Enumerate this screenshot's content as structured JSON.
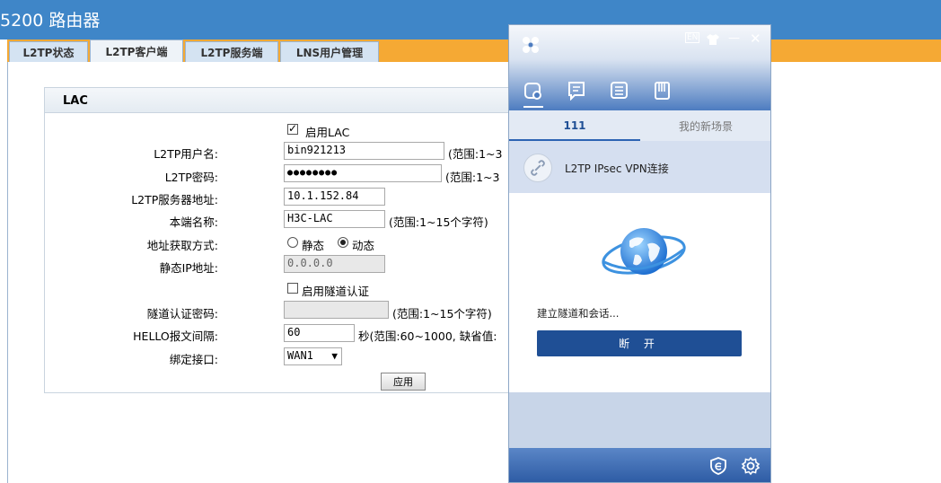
{
  "page": {
    "title": "5200 路由器",
    "tabs": [
      {
        "label": "L2TP状态"
      },
      {
        "label": "L2TP客户端",
        "active": true
      },
      {
        "label": "L2TP服务端"
      },
      {
        "label": "LNS用户管理"
      }
    ]
  },
  "lac": {
    "header": "LAC",
    "enable_lac_label": "启用LAC",
    "enable_lac_checked": true,
    "username_label": "L2TP用户名:",
    "username_value": "bin921213",
    "username_hint": "(范围:1~3",
    "password_label": "L2TP密码:",
    "password_value": "●●●●●●●●",
    "password_hint": "(范围:1~3",
    "server_label": "L2TP服务器地址:",
    "server_value": "10.1.152.84",
    "localname_label": "本端名称:",
    "localname_value": "H3C-LAC",
    "localname_hint": "(范围:1~15个字符)",
    "addrmode_label": "地址获取方式:",
    "addrmode_static": "静态",
    "addrmode_dynamic": "动态",
    "addrmode_selected": "动态",
    "staticip_label": "静态IP地址:",
    "staticip_value": "0.0.0.0",
    "tunnel_auth_label": "启用隧道认证",
    "tunnel_auth_checked": false,
    "tunnel_pwd_label": "隧道认证密码:",
    "tunnel_pwd_value": "",
    "tunnel_pwd_hint": "(范围:1~15个字符)",
    "hello_label": "HELLO报文间隔:",
    "hello_value": "60",
    "hello_hint": "秒(范围:60~1000, 缺省值:",
    "bind_label": "绑定接口:",
    "bind_value": "WAN1",
    "apply_label": "应用"
  },
  "vpn": {
    "lang_label": "EN",
    "minimize": "—",
    "close": "✕",
    "tab_active": "111",
    "tab_other": "我的新场景",
    "connection_name": "L2TP IPsec VPN连接",
    "status_text": "建立隧道和会话...",
    "disconnect_label": "断 开"
  },
  "colors": {
    "title_bar": "#3f86c8",
    "tab_bar": "#f5a934",
    "vpn_button": "#1f4f95"
  }
}
